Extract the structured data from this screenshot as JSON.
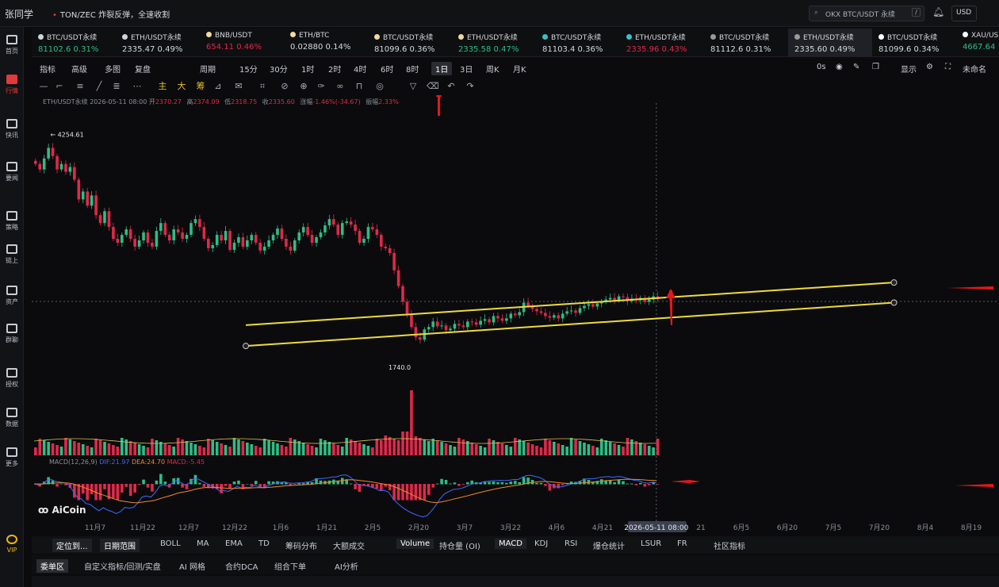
{
  "app": {
    "brand": "张同学",
    "news": "TON/ZEC 炸裂反弹，全速收割",
    "search_placeholder": "OKX BTC/USDT 永续",
    "search_shortcut": "/",
    "currency": "USD"
  },
  "sidebar": [
    {
      "label": "首页",
      "icon": "home-icon"
    },
    {
      "label": "行情",
      "icon": "chart-icon"
    },
    {
      "label": "快讯",
      "icon": "news-icon"
    },
    {
      "label": "要闻",
      "icon": "article-icon"
    },
    {
      "label": "策略",
      "icon": "robot-icon"
    },
    {
      "label": "链上",
      "icon": "chain-icon"
    },
    {
      "label": "资产",
      "icon": "wallet-icon"
    },
    {
      "label": "群聊",
      "icon": "chat-icon"
    },
    {
      "label": "授权",
      "icon": "key-icon"
    },
    {
      "label": "数据",
      "icon": "data-icon"
    },
    {
      "label": "更多",
      "icon": "grid-icon"
    },
    {
      "label": "VIP",
      "icon": "vip-icon"
    }
  ],
  "tickers": [
    {
      "symbol": "BTC/USDT永续",
      "price": "81102.6",
      "change": "0.31%",
      "dir": "up",
      "icon": "x"
    },
    {
      "symbol": "ETH/USDT永续",
      "price": "2335.47",
      "change": "0.49%",
      "dir": "neu",
      "icon": "x"
    },
    {
      "symbol": "BNB/USDT",
      "price": "654.11",
      "change": "0.46%",
      "dir": "dn",
      "icon": "b"
    },
    {
      "symbol": "ETH/BTC",
      "price": "0.02880",
      "change": "0.14%",
      "dir": "neu",
      "icon": "b"
    },
    {
      "symbol": "BTC/USDT永续",
      "price": "81099.6",
      "change": "0.36%",
      "dir": "neu",
      "icon": "b"
    },
    {
      "symbol": "ETH/USDT永续",
      "price": "2335.58",
      "change": "0.47%",
      "dir": "up",
      "icon": "b"
    },
    {
      "symbol": "BTC/USDT永续",
      "price": "81103.4",
      "change": "0.36%",
      "dir": "neu",
      "icon": "t"
    },
    {
      "symbol": "ETH/USDT永续",
      "price": "2335.96",
      "change": "0.43%",
      "dir": "dn",
      "icon": "t"
    },
    {
      "symbol": "BTC/USDT永续",
      "price": "81112.6",
      "change": "0.31%",
      "dir": "neu",
      "icon": "o"
    },
    {
      "symbol": "ETH/USDT永续",
      "price": "2335.60",
      "change": "0.49%",
      "dir": "neu",
      "icon": "o"
    },
    {
      "symbol": "BTC/USDT永续",
      "price": "81099.6",
      "change": "0.34%",
      "dir": "neu",
      "icon": "w"
    },
    {
      "symbol": "XAU/USDT",
      "price": "4667.64",
      "change": "",
      "dir": "up",
      "icon": "w"
    }
  ],
  "toolbar": {
    "left": [
      "指标",
      "高级",
      "多图",
      "复盘",
      "周期"
    ],
    "intervals": [
      "15分",
      "30分",
      "1时",
      "2时",
      "4时",
      "6时",
      "8时",
      "1日",
      "3日",
      "周K",
      "月K"
    ],
    "selected_interval": "1日",
    "right": [
      "0s",
      "显示",
      "未命名"
    ]
  },
  "ohlc": {
    "symbol": "ETH/USDT永续",
    "date": "2026-05-11 08:00",
    "open_label": "开",
    "open": "2370.27",
    "high_label": "高",
    "high": "2374.09",
    "low_label": "低",
    "low": "2318.75",
    "close_label": "收",
    "close": "2335.60",
    "change_label": "涨幅",
    "change": "-1.46%(-34.67)",
    "amp_label": "振幅",
    "amp": "2.33%"
  },
  "macd_label": {
    "name": "MACD(12,26,9)",
    "dif": "DIF:21.97",
    "dea": "DEA:24.70",
    "macd": "MACD:-5.45"
  },
  "logo": "AiCoin",
  "chart_data": {
    "type": "candlestick",
    "symbol": "ETH/USDT永续",
    "interval": "1日",
    "high_marker": "4254.61",
    "low_marker": "1740.0",
    "crosshair_label": "2026-05-11 08:00",
    "x_ticks": [
      "11月7",
      "11月22",
      "12月7",
      "12月22",
      "1月6",
      "1月21",
      "2月5",
      "2月20",
      "3月7",
      "3月22",
      "4月6",
      "4月21",
      "21",
      "6月5",
      "6月20",
      "7月5",
      "7月20",
      "8月4",
      "8月19"
    ],
    "closes": [
      4050,
      3980,
      4120,
      4254,
      4150,
      3980,
      4050,
      3950,
      4010,
      3850,
      3600,
      3700,
      3520,
      3650,
      3400,
      3300,
      3450,
      3250,
      3100,
      3050,
      3150,
      3220,
      3100,
      3000,
      3080,
      3180,
      3050,
      3000,
      3200,
      3300,
      3150,
      3080,
      3220,
      3180,
      3100,
      3150,
      3300,
      3350,
      3250,
      3100,
      2980,
      3020,
      3150,
      3080,
      3200,
      2960,
      3050,
      3120,
      3000,
      3080,
      3150,
      3050,
      2950,
      3000,
      3080,
      3150,
      3230,
      3100,
      3000,
      2950,
      3080,
      3180,
      3250,
      3150,
      3050,
      3120,
      3180,
      3270,
      3350,
      3280,
      3150,
      3300,
      3320,
      3280,
      3200,
      3050,
      3100,
      3250,
      3220,
      3150,
      3000,
      2980,
      2920,
      2700,
      2500,
      2300,
      2150,
      1980,
      1850,
      1820,
      1950,
      1980,
      2050,
      1990,
      2000,
      1940,
      1960,
      2020,
      2000,
      1980,
      2050,
      2040,
      2010,
      2060,
      2080,
      2040,
      2120,
      2090,
      2060,
      2090,
      2150,
      2130,
      2170,
      2290,
      2250,
      2210,
      2180,
      2160,
      2120,
      2100,
      2130,
      2090,
      2150,
      2180,
      2190,
      2160,
      2220,
      2250,
      2270,
      2240,
      2280,
      2300,
      2330,
      2350,
      2320,
      2370,
      2360,
      2310,
      2340,
      2320,
      2350,
      2300,
      2330,
      2370,
      2335
    ],
    "channel": {
      "upper": [
        [
          "2026-02-05",
          2005
        ],
        [
          "2026-07-05",
          2545
        ]
      ],
      "lower": [
        [
          "2026-02-05",
          1740
        ],
        [
          "2026-07-05",
          2290
        ]
      ]
    },
    "colors": {
      "up": "#2ebd85",
      "down": "#e0294a",
      "channel": "#eddc3c",
      "annotation": "#e8161b",
      "dif": "#3d6bff",
      "dea": "#f08a24"
    }
  },
  "bottom1": {
    "items": [
      "定位到...",
      "日期范围",
      "BOLL",
      "MA",
      "EMA",
      "TD",
      "筹码分布",
      "大额成交",
      "Volume",
      "持仓量 (OI)",
      "MACD",
      "KDJ",
      "RSI",
      "爆仓统计",
      "LSUR",
      "FR",
      "社区指标"
    ]
  },
  "bottom2": {
    "items": [
      "委单区",
      "自定义指标/回测/实盘",
      "AI 网格",
      "合约DCA",
      "组合下单",
      "AI分析"
    ]
  }
}
